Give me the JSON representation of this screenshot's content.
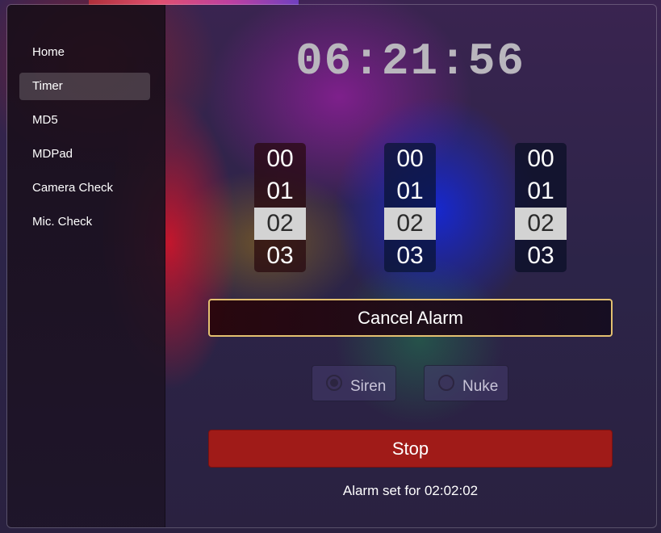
{
  "sidebar": {
    "items": [
      {
        "label": "Home"
      },
      {
        "label": "Timer"
      },
      {
        "label": "MD5"
      },
      {
        "label": "MDPad"
      },
      {
        "label": "Camera Check"
      },
      {
        "label": "Mic. Check"
      }
    ],
    "active_item": "Timer"
  },
  "clock": {
    "time": "06:21:56"
  },
  "pickers": {
    "hours": {
      "digits": [
        "00",
        "01",
        "02",
        "03"
      ],
      "selected": "02"
    },
    "minutes": {
      "digits": [
        "00",
        "01",
        "02",
        "03"
      ],
      "selected": "02"
    },
    "seconds": {
      "digits": [
        "00",
        "01",
        "02",
        "03"
      ],
      "selected": "02"
    }
  },
  "actions": {
    "cancel_alarm_label": "Cancel Alarm",
    "stop_label": "Stop"
  },
  "sounds": {
    "options": [
      {
        "label": "Siren",
        "checked": true
      },
      {
        "label": "Nuke",
        "checked": false
      }
    ]
  },
  "status": {
    "text": "Alarm set for 02:02:02"
  },
  "colors": {
    "stop_button": "#a01b18",
    "cancel_border": "#e3c070",
    "picker_selected": "#d3d3d3",
    "clock_text": "#b9b6bd"
  }
}
